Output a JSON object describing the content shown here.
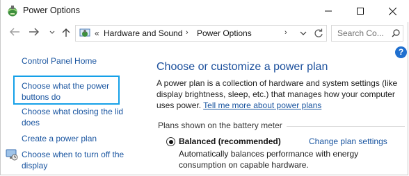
{
  "window": {
    "title": "Power Options",
    "minimize_icon": "minimize-icon",
    "maximize_icon": "maximize-icon",
    "close_icon": "close-icon"
  },
  "navigation": {
    "breadcrumb_prefix": "«",
    "crumbs": [
      "Hardware and Sound",
      "Power Options"
    ],
    "separator": "›",
    "search_placeholder": "Search Co..."
  },
  "sidebar": {
    "items": [
      {
        "label": "Control Panel Home"
      },
      {
        "label": "Choose what the power buttons do",
        "line1": "Choose what the power",
        "line2": "buttons do"
      },
      {
        "label": "Choose what closing the lid does",
        "line1": "Choose what closing the lid",
        "line2": "does"
      },
      {
        "label": "Create a power plan"
      },
      {
        "label": "Choose when to turn off the display",
        "line1": "Choose when to turn off the",
        "line2": "display"
      }
    ]
  },
  "main": {
    "heading": "Choose or customize a power plan",
    "description": "A power plan is a collection of hardware and system settings (like display brightness, sleep, etc.) that manages how your computer uses power.",
    "learn_more_link": "Tell me more about power plans",
    "group_label": "Plans shown on the battery meter",
    "plan": {
      "name": "Balanced (recommended)",
      "change_link": "Change plan settings",
      "description": "Automatically balances performance with energy consumption on capable hardware."
    }
  },
  "colors": {
    "link": "#1a55a0",
    "heading": "#1b4f9c",
    "highlight_border": "#14a0e8",
    "help_icon": "#1f6fcf"
  }
}
